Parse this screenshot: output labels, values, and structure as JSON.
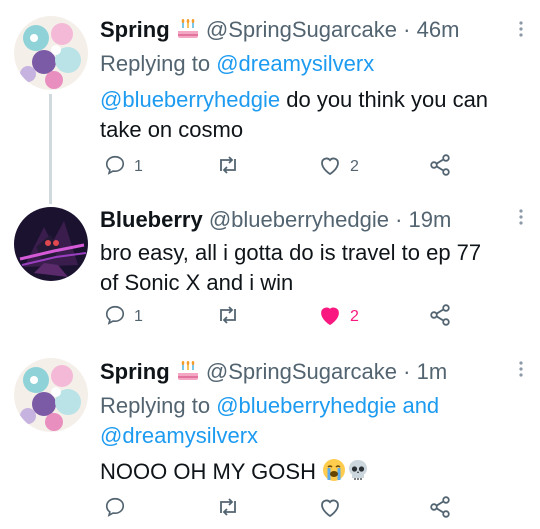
{
  "tweets": [
    {
      "name": "Spring",
      "handle": "@SpringSugarcake",
      "separator": "·",
      "time": "46m",
      "replying_prefix": "Replying to",
      "replying_to": "@dreamysilverx",
      "replying_join": "",
      "replying_to_2": "",
      "body_mention": "@blueberryhedgie",
      "body_line1": " do you think you can",
      "body_line2": "take on cosmo",
      "replies": "1",
      "retweets": "",
      "likes": "2",
      "liked": false
    },
    {
      "name": "Blueberry",
      "handle": "@blueberryhedgie",
      "separator": "·",
      "time": "19m",
      "body_line1": "bro easy, all i gotta do is travel to ep 77",
      "body_line2": "of Sonic X and i win",
      "replies": "1",
      "retweets": "",
      "likes": "2",
      "liked": true
    },
    {
      "name": "Spring",
      "handle": "@SpringSugarcake",
      "separator": "·",
      "time": "1m",
      "replying_prefix": "Replying to",
      "replying_to": "@blueberryhedgie",
      "replying_join": "and",
      "replying_to_2": "@dreamysilverx",
      "body_line1": "NOOO OH MY GOSH",
      "replies": "",
      "retweets": "",
      "likes": "",
      "liked": false
    }
  ],
  "colors": {
    "accent": "#1d9bf0",
    "like_active": "#f91880",
    "muted": "#536471"
  },
  "icons": {
    "name_badge": "birthday-cake-icon",
    "emoji_1": "loudly-crying-face-icon",
    "emoji_2": "skull-icon"
  }
}
